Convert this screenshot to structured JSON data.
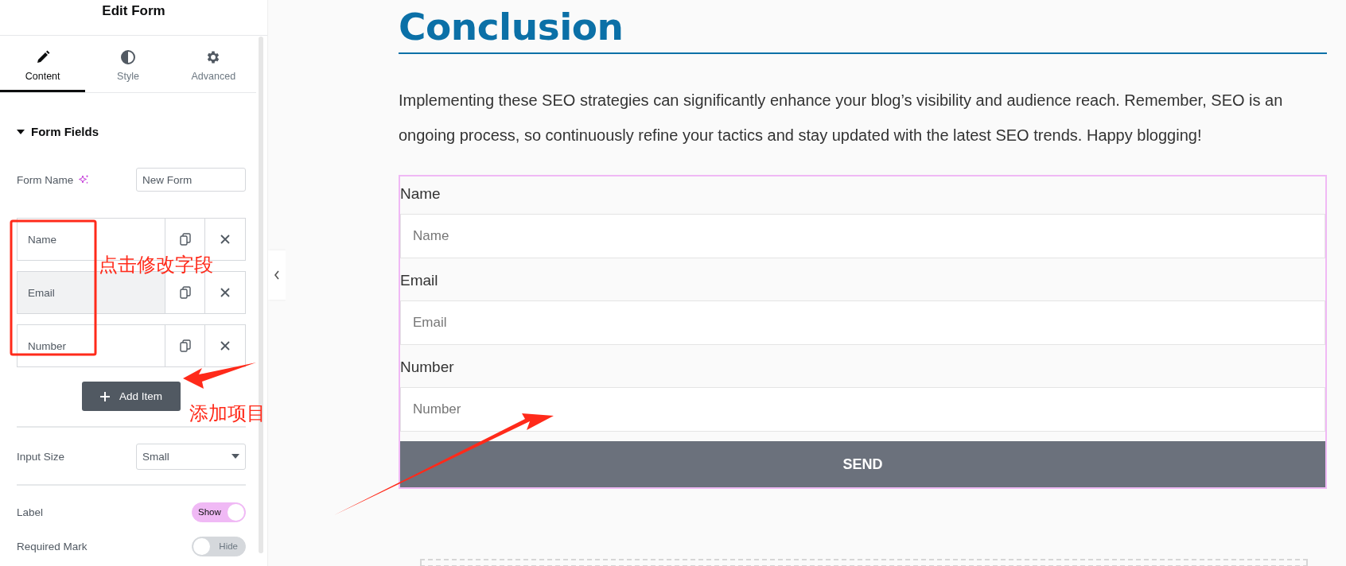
{
  "panel": {
    "title": "Edit Form",
    "tabs": [
      {
        "label": "Content",
        "selected": true
      },
      {
        "label": "Style",
        "selected": false
      },
      {
        "label": "Advanced",
        "selected": false
      }
    ],
    "section": {
      "title": "Form Fields",
      "expanded": true
    },
    "form_name": {
      "label": "Form Name",
      "value": "New Form"
    },
    "fields": [
      {
        "label": "Name",
        "selected": false
      },
      {
        "label": "Email",
        "selected": true
      },
      {
        "label": "Number",
        "selected": false
      }
    ],
    "add_button": "Add Item",
    "input_size": {
      "label": "Input Size",
      "value": "Small"
    },
    "toggles": [
      {
        "label": "Label",
        "on": true,
        "text": "Show"
      },
      {
        "label": "Required Mark",
        "on": false,
        "text": "Hide"
      }
    ]
  },
  "annotations": {
    "field_note": "点击修改字段",
    "add_note": "添加项目"
  },
  "article": {
    "heading": "Conclusion",
    "paragraph": "Implementing these SEO strategies can significantly enhance your blog’s visibility and audience reach. Remember, SEO is an ongoing process, so continuously refine your tactics and stay updated with the latest SEO trends. Happy blogging!",
    "form": {
      "fields": [
        {
          "label": "Name",
          "placeholder": "Name"
        },
        {
          "label": "Email",
          "placeholder": "Email"
        },
        {
          "label": "Number",
          "placeholder": "Number"
        }
      ],
      "submit": "SEND"
    }
  }
}
